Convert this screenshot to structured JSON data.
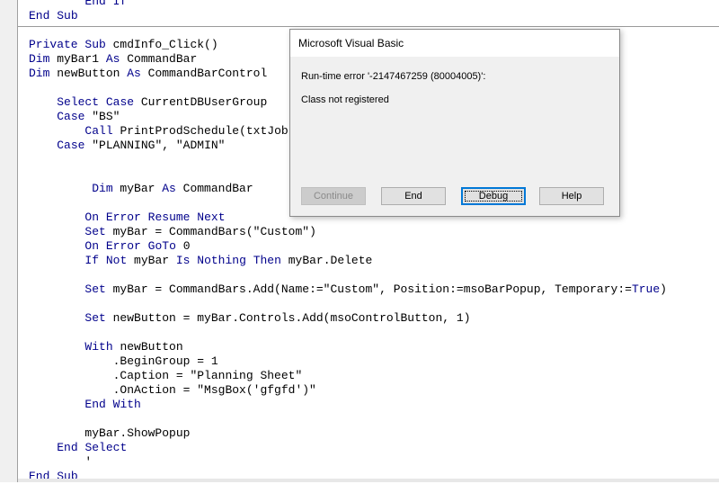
{
  "code": {
    "lines": [
      "        End If",
      "End Sub",
      "",
      "Private Sub cmdInfo_Click()",
      "Dim myBar1 As CommandBar",
      "Dim newButton As CommandBarControl",
      "",
      "    Select Case CurrentDBUserGroup",
      "    Case \"BS\"",
      "        Call PrintProdSchedule(txtJob",
      "    Case \"PLANNING\", \"ADMIN\"",
      "",
      "",
      "         Dim myBar As CommandBar",
      "",
      "        On Error Resume Next",
      "        Set myBar = CommandBars(\"Custom\")",
      "        On Error GoTo 0",
      "        If Not myBar Is Nothing Then myBar.Delete",
      "",
      "        Set myBar = CommandBars.Add(Name:=\"Custom\", Position:=msoBarPopup, Temporary:=True)",
      "",
      "        Set newButton = myBar.Controls.Add(msoControlButton, 1)",
      "",
      "        With newButton",
      "            .BeginGroup = 1",
      "            .Caption = \"Planning Sheet\"",
      "            .OnAction = \"MsgBox('gfgfd')\"",
      "        End With",
      "",
      "        myBar.ShowPopup",
      "    End Select",
      "        '",
      "End Sub"
    ],
    "keywords": [
      "End If",
      "End Sub",
      "Private Sub",
      "Sub",
      "Dim",
      "As",
      "Select Case",
      "Case",
      "Call",
      "On Error Resume Next",
      "On Error GoTo",
      "Set",
      "If",
      "Not",
      "Is",
      "Nothing",
      "Then",
      "With",
      "End With",
      "End Select",
      "True",
      "Resume",
      "Next",
      "GoTo",
      "Error",
      "On",
      "End",
      "Private",
      "Select"
    ]
  },
  "dialog": {
    "title": "Microsoft Visual Basic",
    "message_error": "Run-time error '-2147467259 (80004005)':",
    "message_detail": "Class not registered",
    "buttons": {
      "continue": "Continue",
      "end": "End",
      "debug": "Debug",
      "help": "Help"
    }
  },
  "colors": {
    "keyword": "#00008b",
    "text": "#000000",
    "dialog_bg": "#f0f0f0",
    "focus_border": "#0078d7"
  }
}
